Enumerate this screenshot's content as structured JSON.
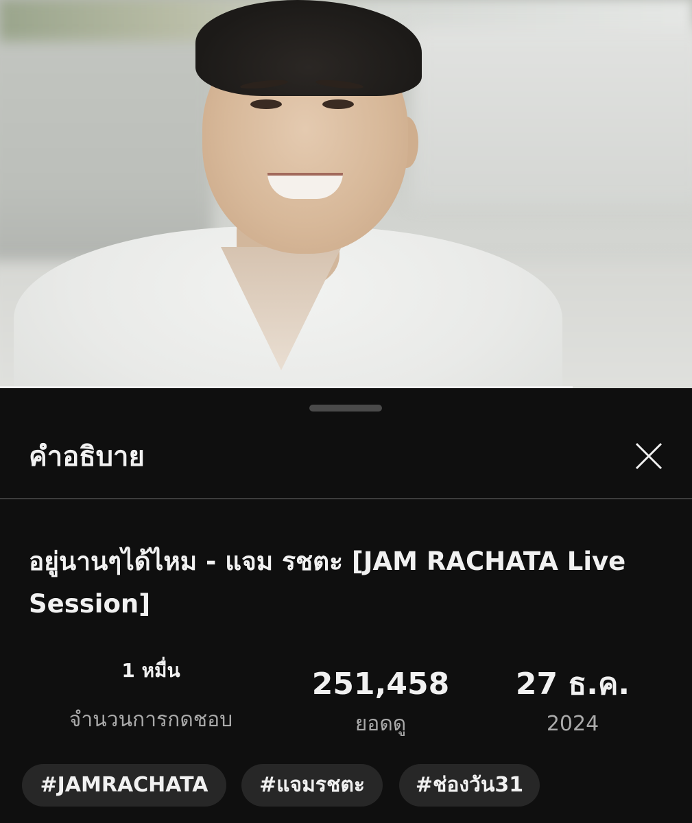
{
  "sheet": {
    "title": "คำอธิบาย",
    "close_icon": "close-icon"
  },
  "video": {
    "title": "อยู่นานๆได้ไหม - แจม รชตะ [JAM RACHATA Live Session]"
  },
  "stats": {
    "likes_value": "1 หมื่น",
    "likes_label": "จำนวนการกดชอบ",
    "views_value": "251,458",
    "views_label": "ยอดดู",
    "date_value": "27 ธ.ค.",
    "date_year": "2024"
  },
  "hashtags": [
    "#JAMRACHATA",
    "#แจมรชตะ",
    "#ช่องวัน31"
  ],
  "colors": {
    "background": "#0f0f0f",
    "chip_bg": "#272727",
    "primary_text": "#f1f1f1",
    "secondary_text": "#aaaaaa"
  }
}
